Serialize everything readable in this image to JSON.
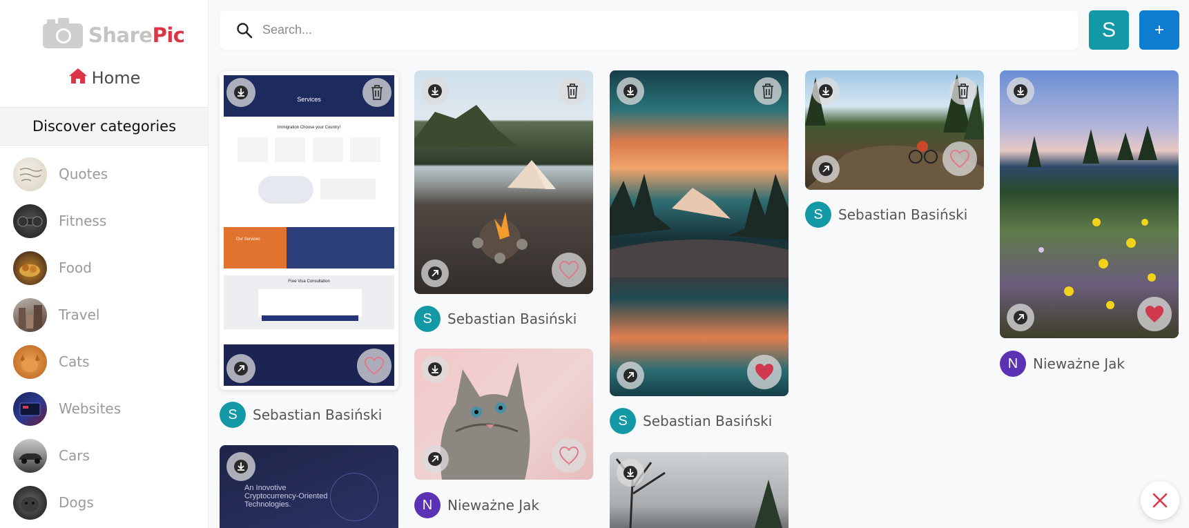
{
  "app": {
    "logo_share": "Share",
    "logo_pic": "Pic"
  },
  "nav": {
    "home_label": "Home"
  },
  "sidebar": {
    "categories_title": "Discover categories",
    "categories": [
      {
        "label": "Quotes"
      },
      {
        "label": "Fitness"
      },
      {
        "label": "Food"
      },
      {
        "label": "Travel"
      },
      {
        "label": "Cats"
      },
      {
        "label": "Websites"
      },
      {
        "label": "Cars"
      },
      {
        "label": "Dogs"
      }
    ]
  },
  "search": {
    "placeholder": "Search..."
  },
  "user": {
    "initial": "S"
  },
  "add_button": {
    "label": "+"
  },
  "pins": [
    {
      "author_initial": "S",
      "author_name": "Sebastian Basiński",
      "avatar_color": "#1398a6",
      "liked": false
    },
    {
      "author_initial": "S",
      "author_name": "Sebastian Basiński",
      "avatar_color": "#1398a6",
      "liked": false
    },
    {
      "author_initial": "N",
      "author_name": "Nieważne Jak",
      "avatar_color": "#5b32b4",
      "liked": false
    },
    {
      "author_initial": "S",
      "author_name": "Sebastian Basiński",
      "avatar_color": "#1398a6",
      "liked": true
    },
    {
      "author_initial": "S",
      "author_name": "Sebastian Basiński",
      "avatar_color": "#1398a6",
      "liked": false
    },
    {
      "author_initial": "N",
      "author_name": "Nieważne Jak",
      "avatar_color": "#5b32b4",
      "liked": true
    }
  ],
  "website_pin_texts": {
    "services_heading": "Services",
    "immigration_heading": "Immigration Choose your Country!",
    "services_box": "Our Services",
    "consultation": "Free Visa Consultation",
    "crypto_headline_1": "An Inovotive",
    "crypto_headline_2": "Cryptocurrency-Oriented",
    "crypto_headline_3": "Technologies."
  },
  "colors": {
    "accent_red": "#dc3545",
    "teal": "#1398a6",
    "blue": "#0d7cd1",
    "purple": "#5b32b4"
  }
}
